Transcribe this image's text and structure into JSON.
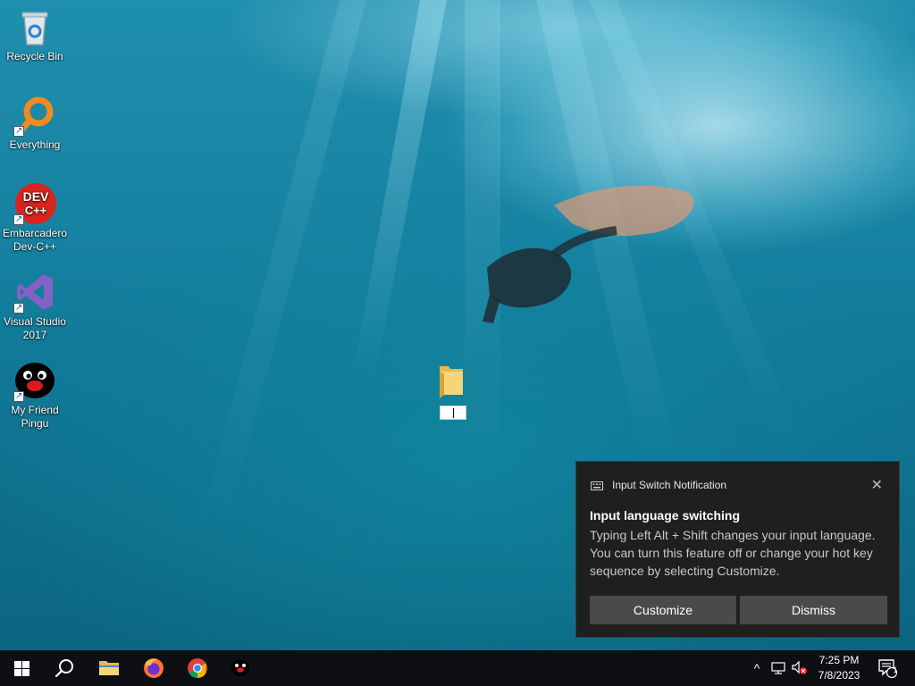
{
  "desktop": {
    "icons": [
      {
        "label_1": "Recycle Bin",
        "label_2": "",
        "icon": "recycle-bin-icon"
      },
      {
        "label_1": "Everything",
        "label_2": "",
        "icon": "everything-search-icon"
      },
      {
        "label_1": "Embarcadero",
        "label_2": "Dev-C++",
        "icon": "dev-cpp-icon",
        "icon_text_1": "DEV",
        "icon_text_2": "C++"
      },
      {
        "label_1": "Visual Studio",
        "label_2": "2017",
        "icon": "visual-studio-icon"
      },
      {
        "label_1": "My Friend",
        "label_2": "Pingu",
        "icon": "pingu-icon"
      }
    ],
    "renaming_folder": {
      "icon": "folder-icon",
      "name_value": ""
    }
  },
  "toast": {
    "app_name": "Input Switch Notification",
    "close_glyph": "✕",
    "title": "Input language switching",
    "body": "Typing Left Alt + Shift changes your input language. You can turn this feature off or change your hot key sequence by selecting Customize.",
    "customize_label": "Customize",
    "dismiss_label": "Dismiss"
  },
  "taskbar": {
    "pinned": [
      "windows-start-icon",
      "search-icon",
      "file-explorer-icon",
      "firefox-icon",
      "chrome-icon",
      "pingu-icon"
    ],
    "tray": {
      "chevron_glyph": "^",
      "time": "7:25 PM",
      "date": "7/8/2023",
      "notification_count": "1"
    }
  },
  "colors": {
    "toast_bg": "#1f1f1f",
    "button_bg": "#4a4a4a",
    "taskbar_bg": "#0d0f12",
    "everything_orange": "#f28a1e",
    "devcpp_red": "#d8231f",
    "vs_purple": "#8661c5"
  }
}
